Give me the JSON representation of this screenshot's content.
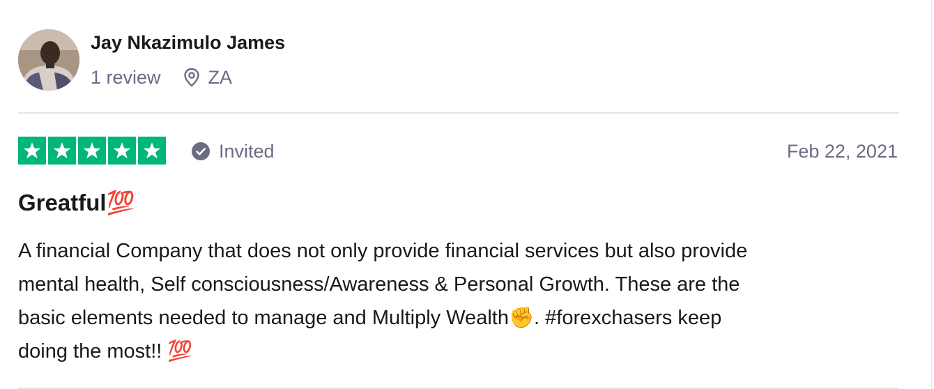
{
  "reviewer": {
    "name": "Jay Nkazimulo James",
    "review_count": "1 review",
    "location": "ZA",
    "location_icon": "map-pin-icon"
  },
  "rating": {
    "stars": 5,
    "max_stars": 5,
    "star_color": "#00b67a"
  },
  "review": {
    "invited_label": "Invited",
    "invited_icon": "check-circle-icon",
    "date": "Feb 22, 2021",
    "title": "Greatful💯",
    "body": "A financial Company that does not only provide financial services but also provide\nmental health, Self consciousness/Awareness & Personal Growth. These are the\nbasic elements needed to manage and Multiply Wealth✊. #forexchasers keep\ndoing the most!! 💯"
  },
  "colors": {
    "muted_text": "#6b6b83",
    "divider": "#e5e5dd",
    "primary_text": "#191919"
  }
}
